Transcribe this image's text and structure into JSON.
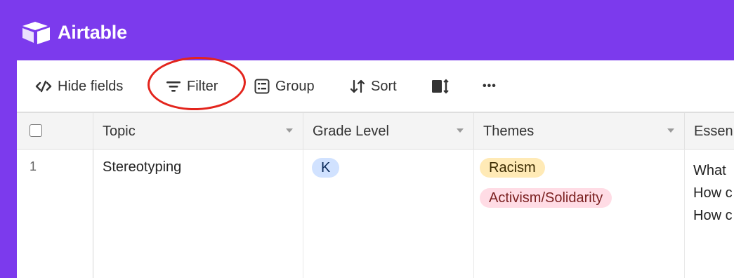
{
  "app": {
    "name": "Airtable",
    "colors": {
      "header_bg": "#7c3aed",
      "highlight_ring": "#e3241c"
    }
  },
  "toolbar": {
    "items": [
      {
        "label": "Hide fields",
        "icon": "hide-fields-icon"
      },
      {
        "label": "Filter",
        "icon": "filter-icon",
        "highlighted": true
      },
      {
        "label": "Group",
        "icon": "group-icon"
      },
      {
        "label": "Sort",
        "icon": "sort-icon"
      },
      {
        "label": "",
        "icon": "row-height-icon"
      },
      {
        "label": "•••",
        "icon": "more-icon"
      }
    ]
  },
  "table": {
    "columns": [
      {
        "label": "Topic"
      },
      {
        "label": "Grade Level"
      },
      {
        "label": "Themes"
      },
      {
        "label": "Essen"
      }
    ],
    "rows": [
      {
        "number": "1",
        "topic": "Stereotyping",
        "grade_level": [
          {
            "label": "K",
            "color": "#d1e2ff"
          }
        ],
        "themes": [
          {
            "label": "Racism",
            "bg": "#ffeab6",
            "fg": "#3a2a00"
          },
          {
            "label": "Activism/Solidarity",
            "bg": "#ffdce5",
            "fg": "#7a1f1f"
          }
        ],
        "essential_lines": [
          "What",
          "How c",
          "How c"
        ]
      }
    ]
  }
}
